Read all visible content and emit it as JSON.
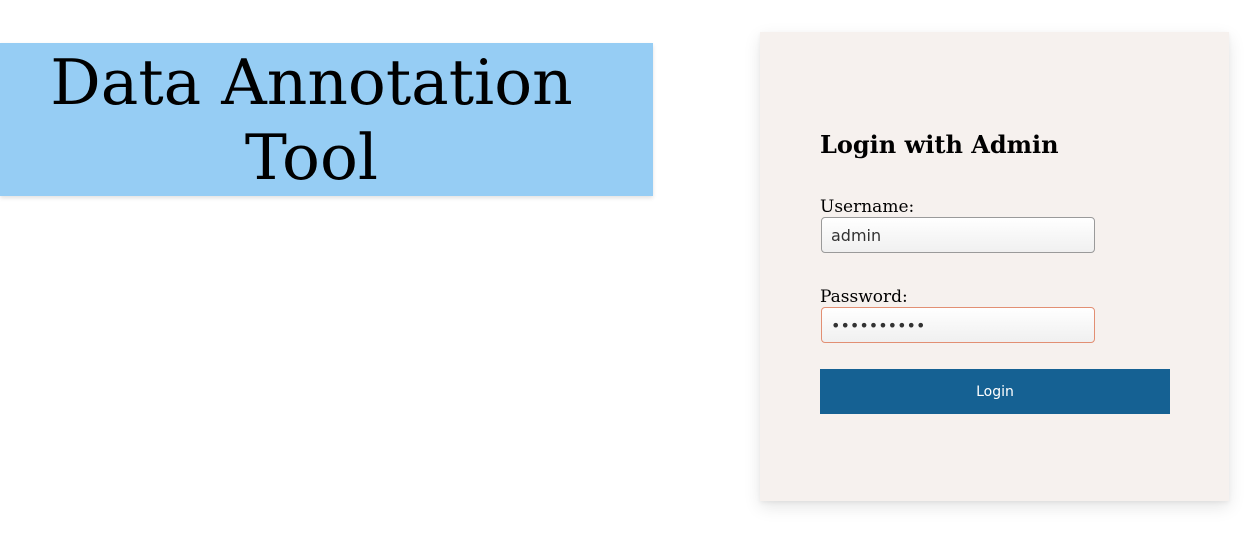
{
  "banner": {
    "title": "Data Annotation Tool",
    "background": "#96cdf4"
  },
  "login_card": {
    "heading": "Login with Admin",
    "background": "#f6f1ee",
    "username": {
      "label": "Username:",
      "value": "admin"
    },
    "password": {
      "label": "Password:",
      "value": "••••••••••",
      "border_color": "#e28f73"
    },
    "login_button": {
      "label": "Login",
      "background": "#156193"
    }
  }
}
